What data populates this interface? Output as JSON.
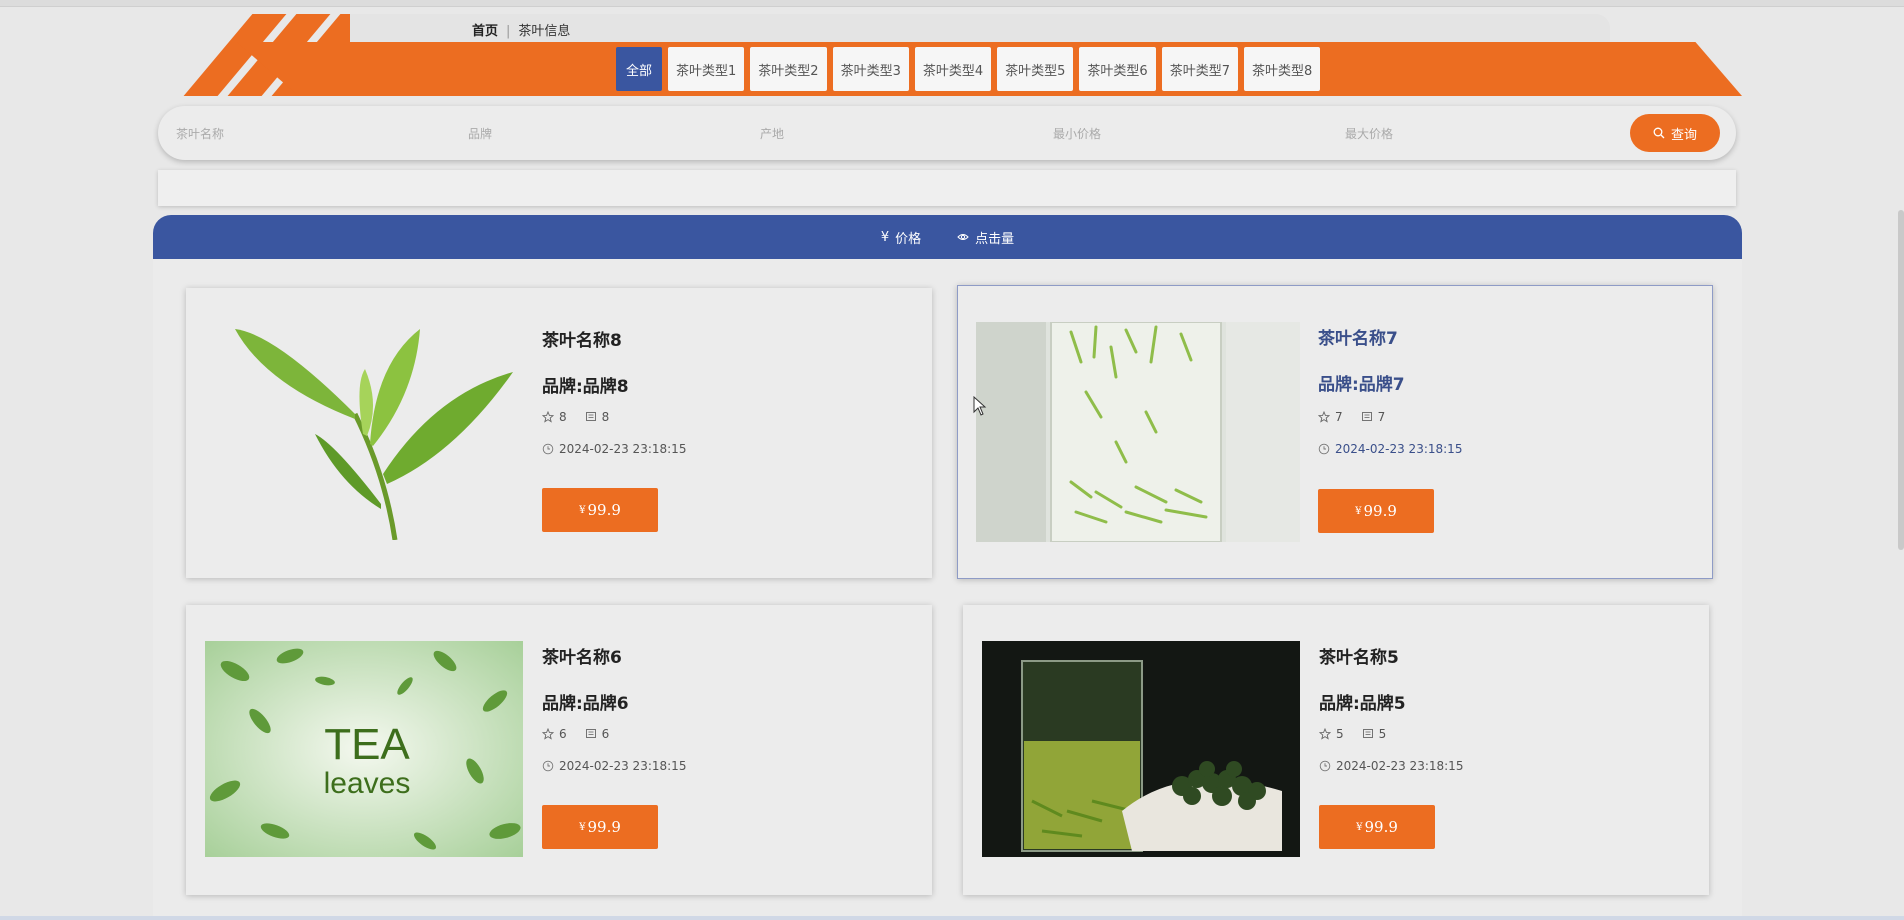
{
  "breadcrumb": {
    "home": "首页",
    "separator": "|",
    "current": "茶叶信息"
  },
  "tabs": [
    "全部",
    "茶叶类型1",
    "茶叶类型2",
    "茶叶类型3",
    "茶叶类型4",
    "茶叶类型5",
    "茶叶类型6",
    "茶叶类型7",
    "茶叶类型8"
  ],
  "search": {
    "name_placeholder": "茶叶名称",
    "brand_placeholder": "品牌",
    "origin_placeholder": "产地",
    "min_price_placeholder": "最小价格",
    "max_price_placeholder": "最大价格",
    "button_label": "查询"
  },
  "sort": {
    "price_label": "价格",
    "price_symbol": "¥",
    "views_label": "点击量"
  },
  "products": [
    {
      "title": "茶叶名称8",
      "brand": "品牌:品牌8",
      "stars": "8",
      "comments": "8",
      "time": "2024-02-23 23:18:15",
      "currency": "¥",
      "price": "99.9",
      "image": "tea-leaf-sprig"
    },
    {
      "title": "茶叶名称7",
      "brand": "品牌:品牌7",
      "stars": "7",
      "comments": "7",
      "time": "2024-02-23 23:18:15",
      "currency": "¥",
      "price": "99.9",
      "image": "tea-in-glass"
    },
    {
      "title": "茶叶名称6",
      "brand": "品牌:品牌6",
      "stars": "6",
      "comments": "6",
      "time": "2024-02-23 23:18:15",
      "currency": "¥",
      "price": "99.9",
      "image": "tea-leaves-poster",
      "image_text_1": "TEA",
      "image_text_2": "leaves"
    },
    {
      "title": "茶叶名称5",
      "brand": "品牌:品牌5",
      "stars": "5",
      "comments": "5",
      "time": "2024-02-23 23:18:15",
      "currency": "¥",
      "price": "99.9",
      "image": "tea-glass-and-leaves"
    }
  ],
  "colors": {
    "accent": "#ec6d21",
    "primary": "#3a56a0",
    "background": "#e8e8e8"
  }
}
